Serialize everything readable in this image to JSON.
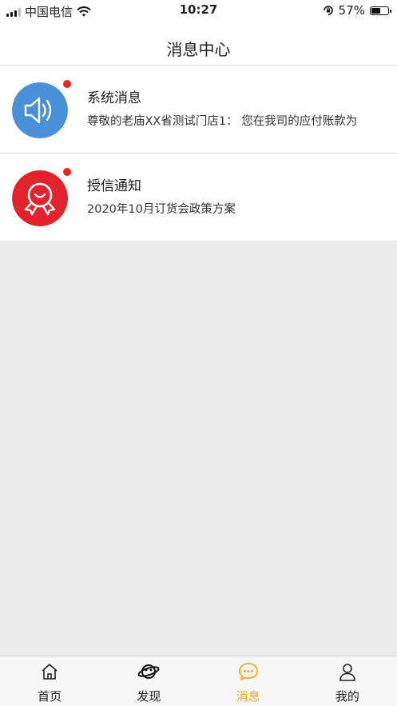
{
  "status_bar": {
    "carrier": "中国电信",
    "time": "10:27",
    "battery": "57%",
    "battery_level": 0.57
  },
  "header": {
    "title": "消息中心"
  },
  "messages": [
    {
      "title": "系统消息",
      "preview": "尊敬的老庙XX省测试门店1： 您在我司的应付账款为",
      "icon": "speaker-icon",
      "icon_bg": "#4a90d9",
      "unread": true
    },
    {
      "title": "授信通知",
      "preview": "2020年10月订货会政策方案",
      "icon": "badge-icon",
      "icon_bg": "#e3232c",
      "unread": true
    }
  ],
  "tabbar": {
    "tabs": [
      {
        "label": "首页",
        "icon": "home-icon",
        "active": false
      },
      {
        "label": "发现",
        "icon": "planet-icon",
        "active": false
      },
      {
        "label": "消息",
        "icon": "chat-icon",
        "active": true
      },
      {
        "label": "我的",
        "icon": "person-icon",
        "active": false
      }
    ]
  },
  "colors": {
    "accent": "#f5a623",
    "unread_dot": "#e8261d",
    "background": "#ebebeb"
  }
}
